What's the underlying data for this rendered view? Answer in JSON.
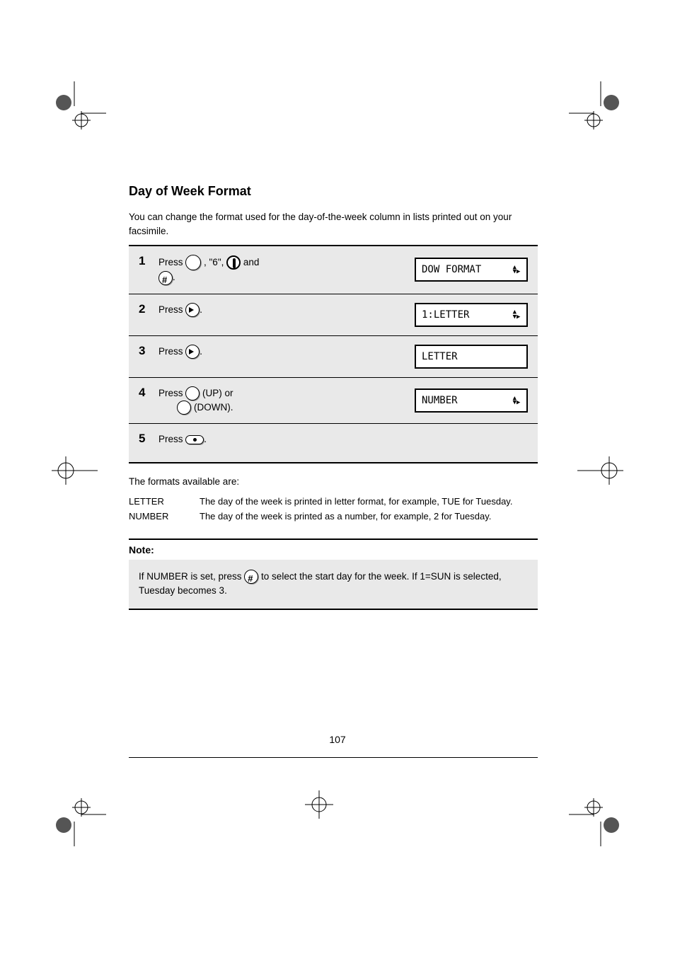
{
  "section": {
    "title": "Day of Week Format",
    "intro": "You can change the format used for the day-of-the-week column in lists printed out on your facsimile."
  },
  "steps": [
    {
      "num": "1",
      "lines": [
        "Press <btn:func>, \"6\", and ",
        "<btn:hash>."
      ],
      "lcd": {
        "text": "DOW FORMAT",
        "arrows": true
      }
    },
    {
      "num": "2",
      "lines": [
        "Press <btn:play>."
      ],
      "lcd": {
        "text": "1:LETTER",
        "arrows": true
      }
    },
    {
      "num": "3",
      "lines": [
        "Press <btn:play>."
      ],
      "lcd": {
        "text": "LETTER",
        "arrows": false
      }
    },
    {
      "num": "4",
      "lines": [
        "Press <btn:round> (UP) or",
        "<btn:round> (DOWN)."
      ],
      "lcd": {
        "text": "NUMBER",
        "arrows": true
      }
    },
    {
      "num": "5",
      "lines": [
        "Press <btn:stop>."
      ]
    }
  ],
  "format_section": {
    "lead": "The formats available are:",
    "rows": [
      {
        "label": "LETTER",
        "desc": "The day of the week is printed in letter format, for example, TUE for Tuesday."
      },
      {
        "label": "NUMBER",
        "desc": "The day of the week is printed as a number, for example, 2 for Tuesday."
      }
    ]
  },
  "note": {
    "label": "Note:",
    "body_pre": "If NUMBER is set, press ",
    "body_post": " to select the start day for the week. If 1=SUN is selected, Tuesday becomes 3."
  },
  "page_number": "107"
}
